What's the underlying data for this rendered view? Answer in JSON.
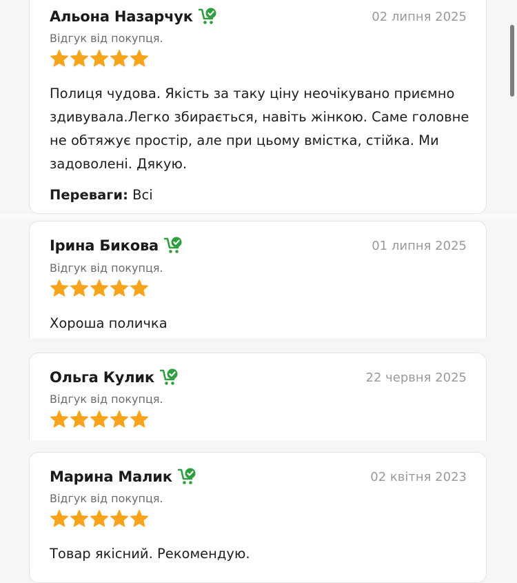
{
  "colors": {
    "accent_green": "#2e9e3f",
    "star": "#f7a41d",
    "date": "#9a9a9a"
  },
  "icons": {
    "verified_buyer": "cart-check-icon",
    "rating_star": "star-icon"
  },
  "reviews": [
    {
      "author": "Альона Назарчук",
      "date": "02 липня 2025",
      "subtitle": "Відгук від покупця.",
      "rating": 5,
      "text": "Полиця чудова. Якість за таку ціну неочікувано приємно здивувала.Легко збирається, навіть жінкою. Саме головне не обтяжує простір, але при цьому вмістка, стійка. Ми задоволені. Дякую.",
      "pros_label": "Переваги:",
      "pros_value": "Всі"
    },
    {
      "author": "Ірина Бикова",
      "date": "01 липня 2025",
      "subtitle": "Відгук від покупця.",
      "rating": 5,
      "text": "Хороша поличка"
    },
    {
      "author": "Ольга Кулик",
      "date": "22 червня 2025",
      "subtitle": "Відгук від покупця.",
      "rating": 5
    },
    {
      "author": "Марина Малик",
      "date": "02 квітня 2023",
      "subtitle": "Відгук від покупця.",
      "rating": 5,
      "text": "Товар якісний. Рекомендую."
    }
  ]
}
